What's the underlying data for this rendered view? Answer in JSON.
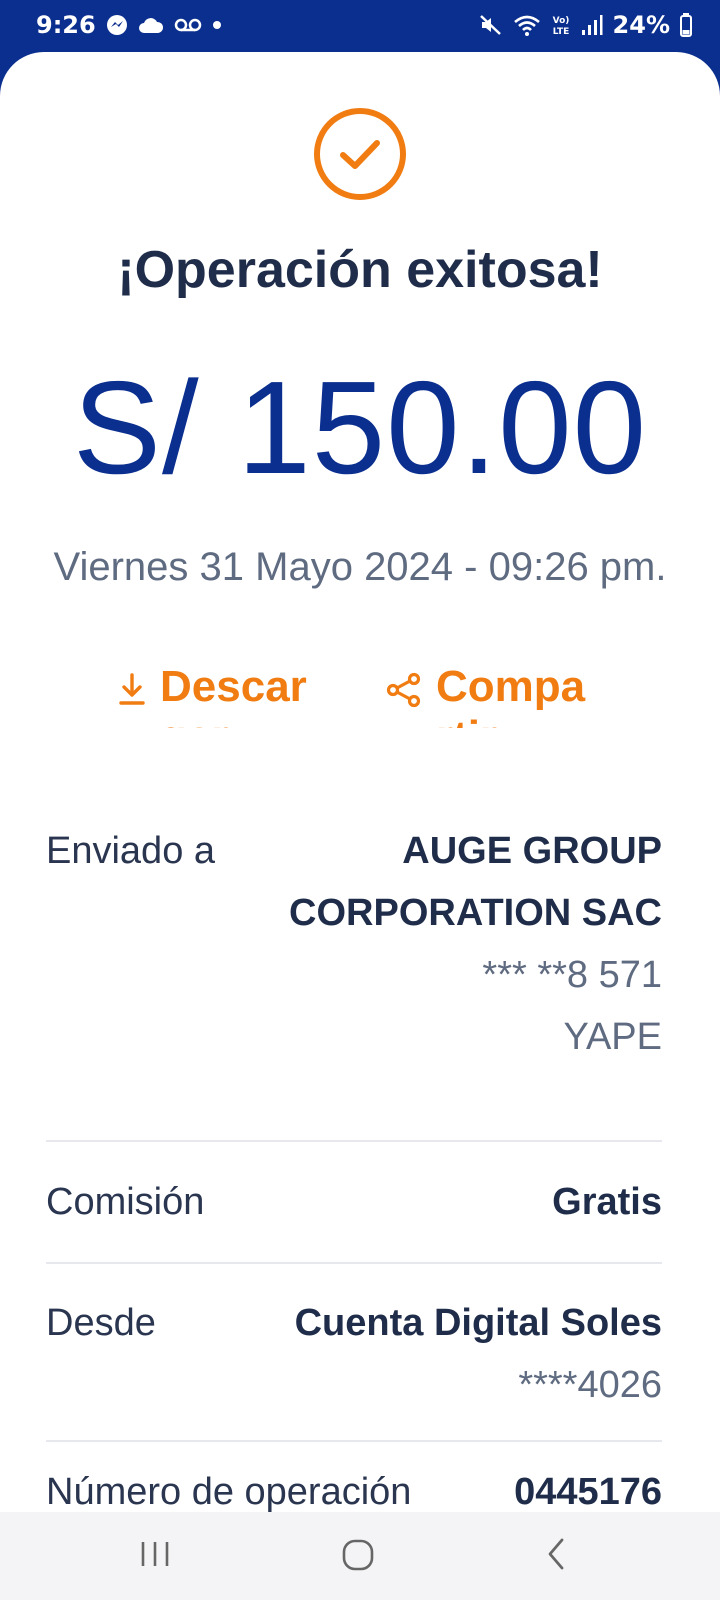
{
  "status_bar": {
    "time": "9:26",
    "battery": "24%",
    "icons": [
      "messenger-icon",
      "cloud-icon",
      "voicemail-icon",
      "dot-icon",
      "mute-icon",
      "wifi-icon",
      "volte-icon",
      "signal-icon",
      "battery-icon"
    ],
    "volte_label": "VoLTE"
  },
  "receipt": {
    "title": "¡Operación exitosa!",
    "amount": "S/ 150.00",
    "datetime": "Viernes 31 Mayo 2024 - 09:26 pm.",
    "accent_color": "#f07c12",
    "brand_color": "#0b2f8f"
  },
  "actions": {
    "download_label": "Descargar",
    "share_label": "Compartir"
  },
  "details": {
    "sent_to_label": "Enviado a",
    "recipient_name_line1": "AUGE GROUP",
    "recipient_name_line2": "CORPORATION SAC",
    "recipient_phone": "*** **8 571",
    "recipient_app": "YAPE",
    "commission_label": "Comisión",
    "commission_value": "Gratis",
    "from_label": "Desde",
    "from_account": "Cuenta Digital Soles",
    "from_account_number": "****4026",
    "operation_number_label": "Número de operación",
    "operation_number": "0445176"
  },
  "nav": {
    "icons": [
      "recents-icon",
      "home-icon",
      "back-icon"
    ]
  }
}
